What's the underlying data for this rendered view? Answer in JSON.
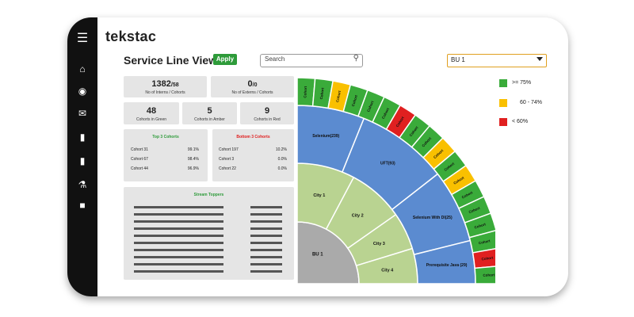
{
  "app": {
    "logo": "tekstac",
    "page_title": "Service Line View",
    "apply_label": "Apply"
  },
  "search": {
    "placeholder": "Search"
  },
  "bu_select": {
    "value": "BU 1"
  },
  "sidebar": {
    "icons": [
      "menu-icon",
      "home-icon",
      "globe-icon",
      "chat-icon",
      "bar-chart-icon",
      "bar-chart-icon",
      "people-icon",
      "square-icon"
    ]
  },
  "stats": {
    "interns": {
      "value": "1382",
      "suffix": "/58",
      "caption": "No of Interns / Cohorts"
    },
    "externs": {
      "value": "0",
      "suffix": "/0",
      "caption": "No of Externs / Cohorts"
    },
    "green": {
      "value": "48",
      "caption": "Cohorts in Green"
    },
    "amber": {
      "value": "5",
      "caption": "Cohorts in Amber"
    },
    "red": {
      "value": "9",
      "caption": "Cohorts in Red"
    }
  },
  "top_cohorts": {
    "title": "Top 3 Cohorts",
    "rows": [
      {
        "name": "Cohort 31",
        "value": "99.1%"
      },
      {
        "name": "Cohort 67",
        "value": "98.4%"
      },
      {
        "name": "Cohort 44",
        "value": "96.9%"
      }
    ]
  },
  "bottom_cohorts": {
    "title": "Bottom 3 Cohorts",
    "rows": [
      {
        "name": "Cohort 197",
        "value": "10.2%"
      },
      {
        "name": "Cohort 3",
        "value": "0.0%"
      },
      {
        "name": "Cohort 22",
        "value": "0.0%"
      }
    ]
  },
  "stream_toppers": {
    "title": "Stream Toppers"
  },
  "sunburst": {
    "center": "BU 1",
    "cities": [
      "City 1",
      "City 2",
      "City 3",
      "City 4"
    ],
    "streams": [
      "Selenium(239)",
      "UFT(93)",
      "Selenium With DI(25)",
      "Prerequisite Java (29)"
    ],
    "cohort_label": "Cohort",
    "cohort_colors": [
      "green",
      "green",
      "amber",
      "green",
      "green",
      "green",
      "red",
      "green",
      "green",
      "amber",
      "green",
      "amber",
      "green",
      "green",
      "green",
      "green",
      "red",
      "green"
    ]
  },
  "legend": [
    {
      "label": ">= 75%",
      "color": "#3aab3a"
    },
    {
      "label": "60 - 74%",
      "color": "#f9c000"
    },
    {
      "label": "< 60%",
      "color": "#e02020"
    }
  ],
  "colors": {
    "green": "#3aab3a",
    "amber": "#f9c000",
    "red": "#e02020",
    "stream": "#5b8bd0",
    "city": "#b9d391",
    "center": "#aaaaaa",
    "accent": "#2e9b3a"
  }
}
